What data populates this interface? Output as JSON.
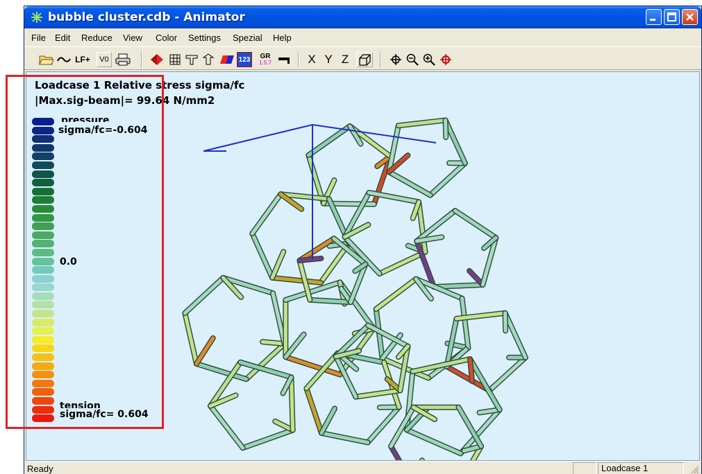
{
  "window": {
    "title": "bubble cluster.cdb - Animator"
  },
  "menu": [
    "File",
    "Edit",
    "Reduce",
    "View",
    "Color",
    "Settings",
    "Spezial",
    "Help"
  ],
  "toolbar": {
    "lf_label": "LF+",
    "v0_label": "V0",
    "gr_label": "GR",
    "gr_sub": "1.5:7",
    "num_label": "123",
    "x_label": "X",
    "y_label": "Y",
    "z_label": "Z"
  },
  "view": {
    "header_line1": "Loadcase   1  Relative stress sigma/fc",
    "header_line2": "|Max.sig-beam|=   99.64 N/mm2",
    "legend": {
      "top_caption": "pressure",
      "top_value": "sigma/fc=-0.604",
      "mid_value": "0.0",
      "bottom_caption": "tension",
      "bottom_value": "sigma/fc= 0.604",
      "colors": [
        "#0a1f8f",
        "#0d2585",
        "#10307a",
        "#12376e",
        "#134063",
        "#134a58",
        "#11544c",
        "#10603f",
        "#127034",
        "#1a7f31",
        "#258c37",
        "#339645",
        "#3fa052",
        "#4aa963",
        "#53b275",
        "#5bba87",
        "#64c29c",
        "#73cbbd",
        "#88d2d2",
        "#97d7cf",
        "#a6dcbc",
        "#b5e0a4",
        "#c4e58a",
        "#d4eb6c",
        "#e6f04e",
        "#f4ee26",
        "#f6d818",
        "#f5c116",
        "#f4aa14",
        "#f39211",
        "#f2790f",
        "#f1600d",
        "#f0460c",
        "#ee2c0c",
        "#ec1a0c"
      ]
    }
  },
  "status": {
    "left": "Ready",
    "loadcase_label": "Loadcase   1"
  },
  "colors": {
    "canvas_bg": "#dcf0fb",
    "highlight": "#e51f1f",
    "titlebar": "#0054e3"
  }
}
